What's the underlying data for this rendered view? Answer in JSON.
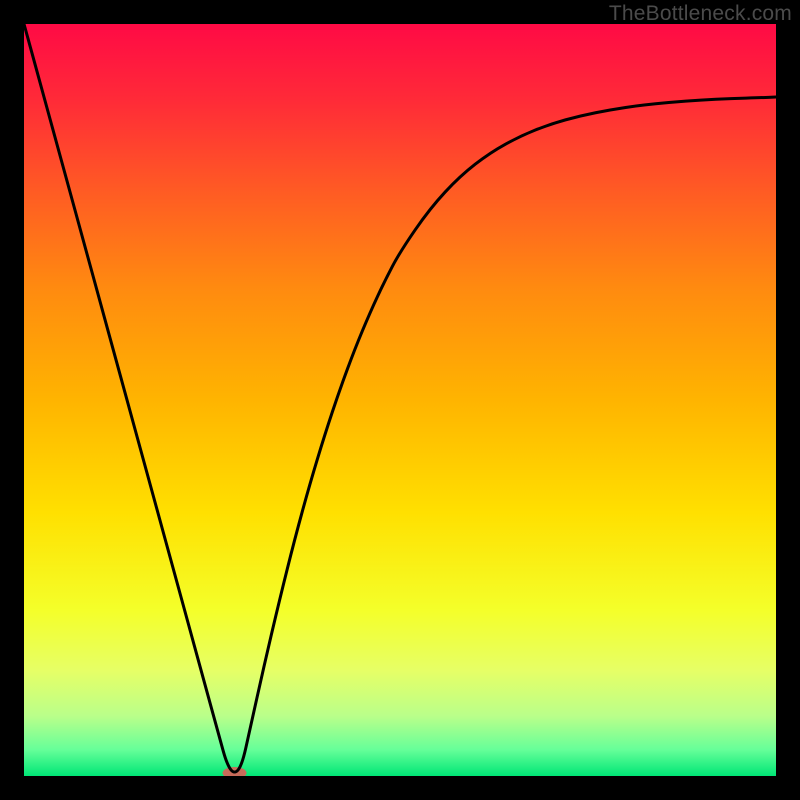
{
  "watermark": "TheBottleneck.com",
  "chart_data": {
    "type": "line",
    "title": "",
    "xlabel": "",
    "ylabel": "",
    "xlim": [
      0,
      100
    ],
    "ylim": [
      0,
      100
    ],
    "grid": false,
    "background_gradient": {
      "stops": [
        {
          "offset": 0.0,
          "color": "#ff0a45"
        },
        {
          "offset": 0.1,
          "color": "#ff2a38"
        },
        {
          "offset": 0.22,
          "color": "#ff5a24"
        },
        {
          "offset": 0.35,
          "color": "#ff8a10"
        },
        {
          "offset": 0.5,
          "color": "#ffb400"
        },
        {
          "offset": 0.65,
          "color": "#ffe000"
        },
        {
          "offset": 0.78,
          "color": "#f4ff2a"
        },
        {
          "offset": 0.86,
          "color": "#e6ff66"
        },
        {
          "offset": 0.92,
          "color": "#baff8a"
        },
        {
          "offset": 0.965,
          "color": "#66ff99"
        },
        {
          "offset": 1.0,
          "color": "#00e676"
        }
      ]
    },
    "series": [
      {
        "name": "bottleneck-curve",
        "stroke": "#000000",
        "stroke_width": 3,
        "x": [
          0,
          2,
          4,
          6,
          8,
          10,
          12,
          14,
          16,
          18,
          20,
          22,
          24,
          26,
          27,
          28,
          29,
          30,
          32,
          34,
          36,
          38,
          40,
          42,
          44,
          46,
          48,
          50,
          54,
          58,
          62,
          66,
          70,
          74,
          78,
          82,
          86,
          90,
          94,
          98,
          100
        ],
        "y": [
          100,
          92.7,
          85.4,
          78.1,
          70.8,
          63.5,
          56.2,
          48.9,
          41.6,
          34.3,
          27.0,
          19.7,
          12.4,
          5.1,
          1.5,
          0.2,
          1.5,
          6.0,
          15.0,
          23.5,
          31.5,
          38.8,
          45.4,
          51.4,
          56.8,
          61.6,
          65.9,
          69.7,
          75.5,
          79.8,
          82.9,
          85.1,
          86.7,
          87.8,
          88.6,
          89.2,
          89.6,
          89.9,
          90.1,
          90.2,
          90.3
        ]
      }
    ],
    "marker": {
      "name": "optimum-marker",
      "x": 28,
      "y": 0,
      "rx": 12,
      "ry": 6,
      "fill": "#c76b5a"
    }
  }
}
